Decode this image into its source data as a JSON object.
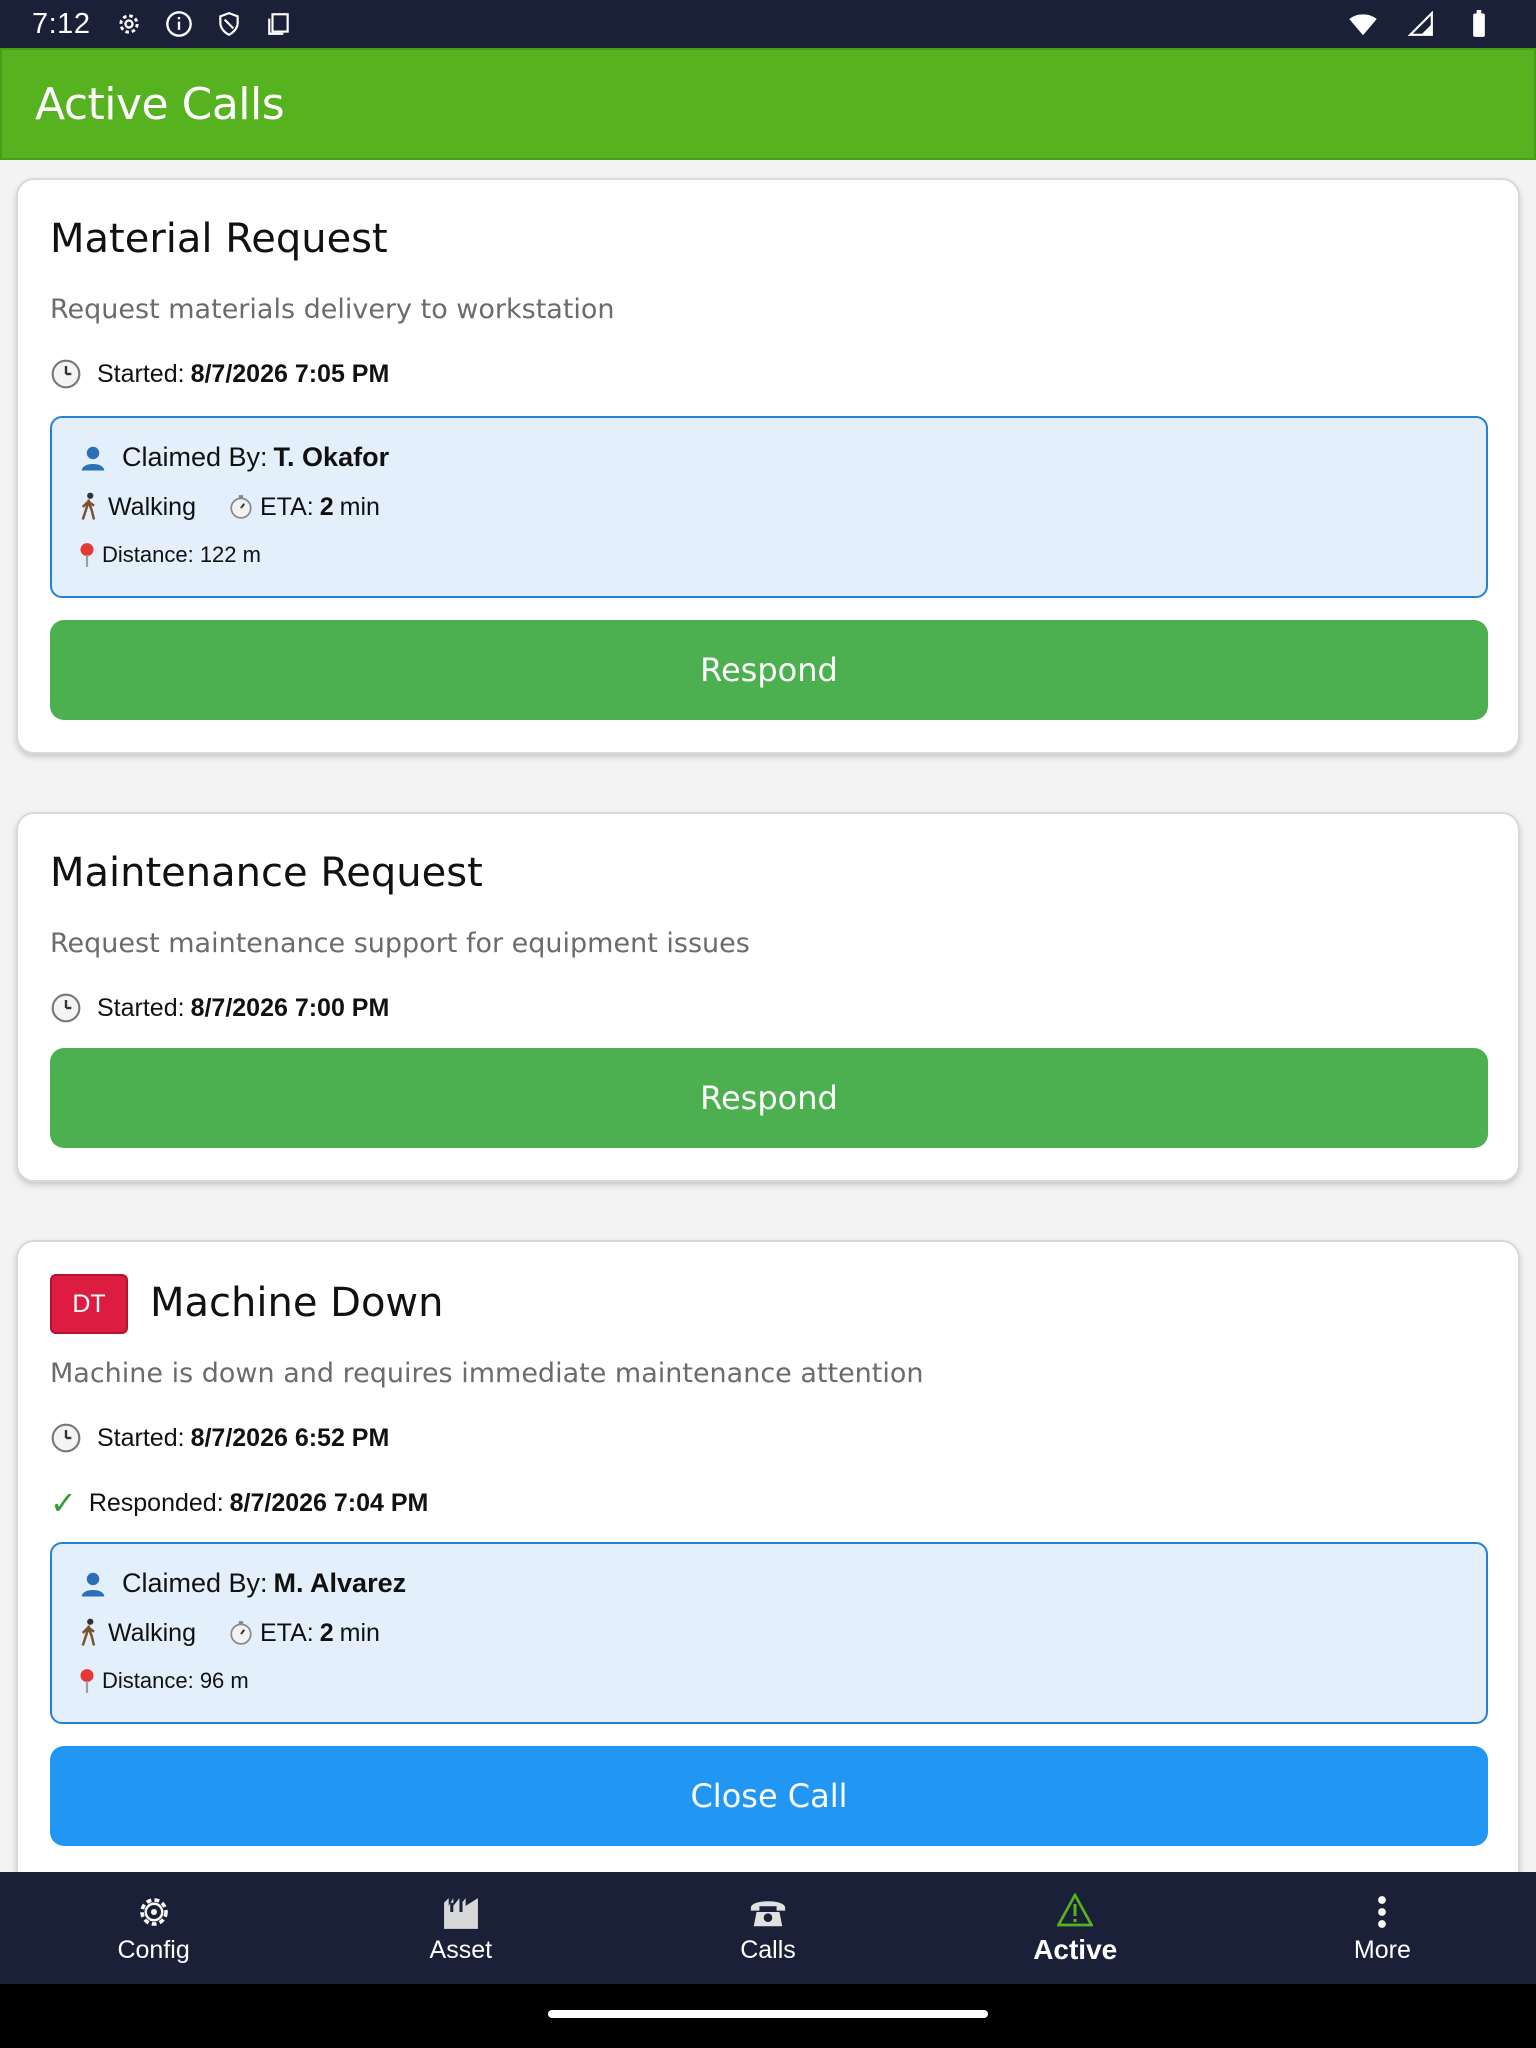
{
  "status_bar": {
    "time": "7:12"
  },
  "app_bar": {
    "title": "Active Calls"
  },
  "calls": [
    {
      "title": "Material Request",
      "description": "Request materials delivery to workstation",
      "started_label": "Started:",
      "started": "8/7/2026 7:05 PM",
      "claim": {
        "claimed_by_label": "Claimed By:",
        "claimed_by": "T. Okafor",
        "mode": "Walking",
        "eta_label": "ETA:",
        "eta_value": "2",
        "eta_unit": "min",
        "distance": "Distance: 122 m"
      },
      "button_label": "Respond"
    },
    {
      "title": "Maintenance Request",
      "description": "Request maintenance support for equipment issues",
      "started_label": "Started:",
      "started": "8/7/2026 7:00 PM",
      "button_label": "Respond"
    },
    {
      "badge": "DT",
      "title": "Machine Down",
      "description": "Machine is down and requires immediate maintenance attention",
      "started_label": "Started:",
      "started": "8/7/2026 6:52 PM",
      "responded_label": "Responded:",
      "responded": "8/7/2026 7:04 PM",
      "claim": {
        "claimed_by_label": "Claimed By:",
        "claimed_by": "M. Alvarez",
        "mode": "Walking",
        "eta_label": "ETA:",
        "eta_value": "2",
        "eta_unit": "min",
        "distance": "Distance: 96 m"
      },
      "button_label": "Close Call"
    }
  ],
  "bottom_nav": [
    {
      "label": "Config",
      "icon": "gear-icon"
    },
    {
      "label": "Asset",
      "icon": "factory-icon"
    },
    {
      "label": "Calls",
      "icon": "phone-icon"
    },
    {
      "label": "Active",
      "icon": "warning-icon",
      "active": true
    },
    {
      "label": "More",
      "icon": "more-vertical-icon"
    }
  ],
  "colors": {
    "app_bar": "#56b21f",
    "respond_button": "#4caf50",
    "close_button": "#2196f3",
    "claim_bg": "#e3f0fb",
    "claim_border": "#2a7fd4",
    "dt_badge": "#dc1c40",
    "nav_bg": "#1a2038"
  }
}
